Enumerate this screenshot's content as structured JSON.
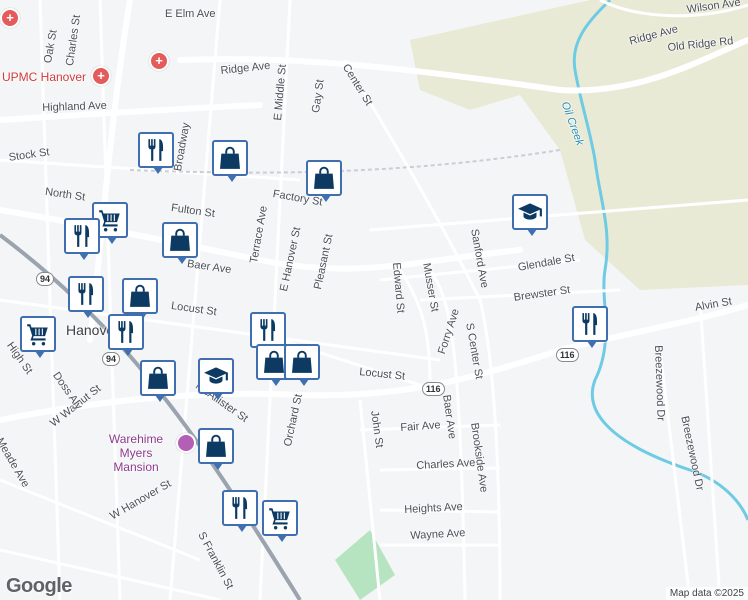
{
  "map": {
    "attribution": "Map data ©2025",
    "logo": "Google",
    "colors": {
      "background": "#f4f5f7",
      "road": "#ffffff",
      "park": "#e9ead6",
      "green": "#b7e4c0",
      "water": "#6ecbe3",
      "marker_border": "#3f6fb0",
      "marker_icon": "#0d3a63"
    }
  },
  "streets": {
    "elm_ave": "E Elm Ave",
    "wilson_ave": "Wilson Ave",
    "ridge_ave_ne": "Ridge Ave",
    "old_ridge_rd": "Old Ridge Rd",
    "oak_st": "Oak St",
    "charles_st": "Charles St",
    "ridge_ave": "Ridge Ave",
    "center_st": "Center St",
    "highland_ave": "Highland Ave",
    "e_middle_st": "E Middle St",
    "gay_st": "Gay St",
    "stock_st": "Stock St",
    "broadway": "Broadway",
    "north_st": "North St",
    "factory_st": "Factory St",
    "fulton_st": "Fulton St",
    "terrace_ave": "Terrace Ave",
    "e_hanover_st": "E Hanover St",
    "pleasant_st": "Pleasant St",
    "baer_ave": "Baer Ave",
    "edward_st": "Edward St",
    "musselman_st": "Musser St",
    "sanford_ave": "Sanford Ave",
    "glendale_st": "Glendale St",
    "brewster_st": "Brewster St",
    "locust_st_w": "Locust St",
    "forry_ave": "Forry Ave",
    "s_center_st": "S Center St",
    "alvin_st": "Alvin St",
    "breezewood_dr_1": "Breezewood Dr",
    "breezewood_dr_2": "Breezewood Dr",
    "locust_st_e": "Locust St",
    "fair_ave": "Fair Ave",
    "baer_ave_s": "Baer Ave",
    "brookside_ave": "Brookside Ave",
    "charles_ave": "Charles Ave",
    "heights_ave": "Heights Ave",
    "wayne_ave": "Wayne Ave",
    "orchard_st": "Orchard St",
    "mcallister_st": "McAllister St",
    "w_walnut_st": "W Walnut St",
    "doss_aly": "Doss Aly",
    "meade_ave": "Meade Ave",
    "w_hanover_st": "W Hanover St",
    "high_st": "High St",
    "s_franklin_st": "S Franklin St",
    "john_st": "John St"
  },
  "places": {
    "hospital": "UPMC Hanover",
    "town": "Hanover",
    "museum": "Warehime Myers Mansion",
    "creek": "Oil Creek"
  },
  "shields": {
    "r94_top": "94",
    "r94_bottom": "94",
    "r116_center": "116",
    "r116_east": "116"
  },
  "markers": [
    {
      "type": "restaurant",
      "icon": "fork-knife-icon"
    },
    {
      "type": "shopping",
      "icon": "shopping-bag-icon"
    },
    {
      "type": "shopping",
      "icon": "shopping-bag-icon"
    },
    {
      "type": "grocery",
      "icon": "shopping-cart-icon"
    },
    {
      "type": "restaurant",
      "icon": "fork-knife-icon"
    },
    {
      "type": "shopping",
      "icon": "shopping-bag-icon"
    },
    {
      "type": "school",
      "icon": "graduation-cap-icon"
    },
    {
      "type": "restaurant",
      "icon": "fork-knife-icon"
    },
    {
      "type": "shopping",
      "icon": "shopping-bag-icon"
    },
    {
      "type": "grocery",
      "icon": "shopping-cart-icon"
    },
    {
      "type": "restaurant",
      "icon": "fork-knife-icon"
    },
    {
      "type": "restaurant",
      "icon": "fork-knife-icon"
    },
    {
      "type": "shopping",
      "icon": "shopping-bag-icon"
    },
    {
      "type": "shopping",
      "icon": "shopping-bag-icon"
    },
    {
      "type": "school",
      "icon": "graduation-cap-icon"
    },
    {
      "type": "shopping",
      "icon": "shopping-bag-icon"
    },
    {
      "type": "shopping",
      "icon": "shopping-bag-icon"
    },
    {
      "type": "restaurant",
      "icon": "fork-knife-icon"
    },
    {
      "type": "grocery",
      "icon": "shopping-cart-icon"
    },
    {
      "type": "restaurant",
      "icon": "fork-knife-icon"
    }
  ]
}
